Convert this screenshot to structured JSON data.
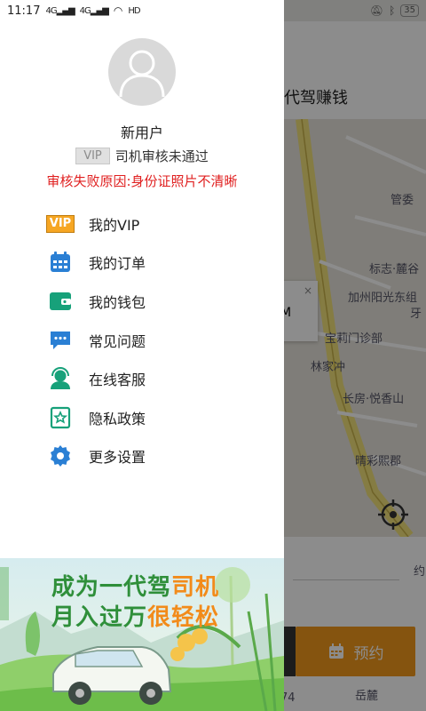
{
  "status_bar": {
    "time": "11:17",
    "signal1": "4G",
    "signal2": "4G",
    "hd": "HD",
    "battery": "35"
  },
  "background_app": {
    "title": "代驾赚钱",
    "map_labels": [
      "管委",
      "标志·麓谷",
      "加州阳光东组",
      "牙",
      "宝莉门诊部",
      "林家冲",
      "长房·悦香山",
      "晴彩熙郡",
      "岳麓",
      "74"
    ],
    "map_card_text": "M",
    "map_card_close": "×",
    "reserve_label": "预约",
    "side_hint": "约"
  },
  "drawer": {
    "user_name": "新用户",
    "vip_badge": "VIP",
    "review_status": "司机审核未通过",
    "fail_reason": "审核失败原因:身份证照片不清晰",
    "menu": [
      {
        "icon": "vip-icon",
        "label": "我的VIP",
        "badge": "VIP"
      },
      {
        "icon": "calendar-icon",
        "label": "我的订单"
      },
      {
        "icon": "wallet-icon",
        "label": "我的钱包"
      },
      {
        "icon": "chat-icon",
        "label": "常见问题"
      },
      {
        "icon": "customer-service-icon",
        "label": "在线客服"
      },
      {
        "icon": "privacy-policy-icon",
        "label": "隐私政策"
      },
      {
        "icon": "gear-icon",
        "label": "更多设置"
      }
    ],
    "banner": {
      "line1_a": "成为一代驾",
      "line1_b": "司机",
      "line2_a": "月入过万",
      "line2_b": "很轻松"
    }
  },
  "colors": {
    "accent_blue": "#2a7fd4",
    "accent_teal": "#17a17a",
    "error_red": "#e02020",
    "reserve_orange": "#f39a1d",
    "banner_green": "#2f8f3a",
    "banner_orange": "#f28b1a"
  }
}
